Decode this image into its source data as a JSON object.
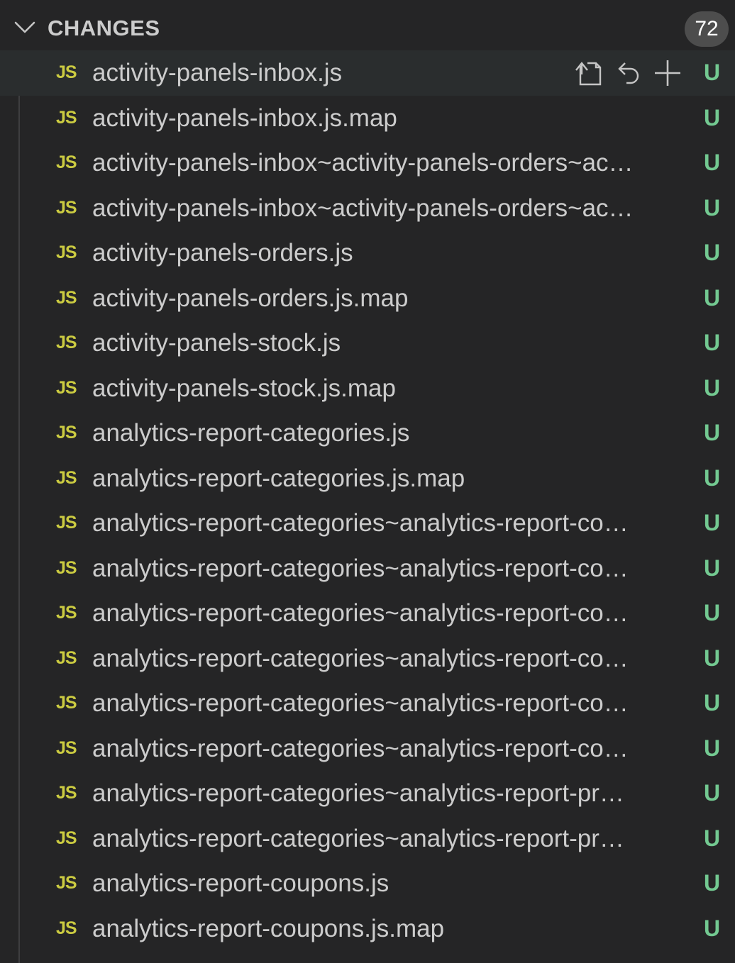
{
  "section": {
    "title": "CHANGES",
    "count": "72"
  },
  "colors": {
    "background": "#252526",
    "hover_row": "#2a2d2e",
    "js_icon": "#cbcb41",
    "untracked_status": "#73c991",
    "text": "#cccccc",
    "badge": "#4d4d4d"
  },
  "row_actions": [
    {
      "name": "open-file-icon"
    },
    {
      "name": "discard-changes-icon"
    },
    {
      "name": "stage-changes-icon"
    }
  ],
  "files": [
    {
      "icon": "JS",
      "name": "activity-panels-inbox.js",
      "status": "U"
    },
    {
      "icon": "JS",
      "name": "activity-panels-inbox.js.map",
      "status": "U"
    },
    {
      "icon": "JS",
      "name": "activity-panels-inbox~activity-panels-orders~ac…",
      "status": "U"
    },
    {
      "icon": "JS",
      "name": "activity-panels-inbox~activity-panels-orders~ac…",
      "status": "U"
    },
    {
      "icon": "JS",
      "name": "activity-panels-orders.js",
      "status": "U"
    },
    {
      "icon": "JS",
      "name": "activity-panels-orders.js.map",
      "status": "U"
    },
    {
      "icon": "JS",
      "name": "activity-panels-stock.js",
      "status": "U"
    },
    {
      "icon": "JS",
      "name": "activity-panels-stock.js.map",
      "status": "U"
    },
    {
      "icon": "JS",
      "name": "analytics-report-categories.js",
      "status": "U"
    },
    {
      "icon": "JS",
      "name": "analytics-report-categories.js.map",
      "status": "U"
    },
    {
      "icon": "JS",
      "name": "analytics-report-categories~analytics-report-co…",
      "status": "U"
    },
    {
      "icon": "JS",
      "name": "analytics-report-categories~analytics-report-co…",
      "status": "U"
    },
    {
      "icon": "JS",
      "name": "analytics-report-categories~analytics-report-co…",
      "status": "U"
    },
    {
      "icon": "JS",
      "name": "analytics-report-categories~analytics-report-co…",
      "status": "U"
    },
    {
      "icon": "JS",
      "name": "analytics-report-categories~analytics-report-co…",
      "status": "U"
    },
    {
      "icon": "JS",
      "name": "analytics-report-categories~analytics-report-co…",
      "status": "U"
    },
    {
      "icon": "JS",
      "name": "analytics-report-categories~analytics-report-pr…",
      "status": "U"
    },
    {
      "icon": "JS",
      "name": "analytics-report-categories~analytics-report-pr…",
      "status": "U"
    },
    {
      "icon": "JS",
      "name": "analytics-report-coupons.js",
      "status": "U"
    },
    {
      "icon": "JS",
      "name": "analytics-report-coupons.js.map",
      "status": "U"
    }
  ]
}
